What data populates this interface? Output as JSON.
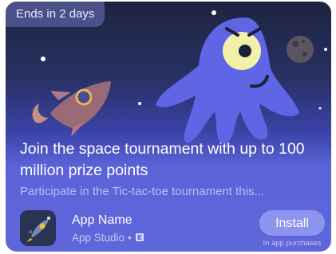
{
  "badge": {
    "text": "Ends in 2 days"
  },
  "title": "Join the space tournament with up to 100 million prize points",
  "description": "Participate in the Tic-tac-toe tournament this...",
  "app": {
    "name": "App Name",
    "studio": "App Studio",
    "separator": "•",
    "rating_icon": "esrb-everyone-icon"
  },
  "install": {
    "label": "Install",
    "note": "In app purchases"
  },
  "colors": {
    "accent": "#8c95ee",
    "monster": "#5e66e6",
    "badge": "#4a5088"
  }
}
